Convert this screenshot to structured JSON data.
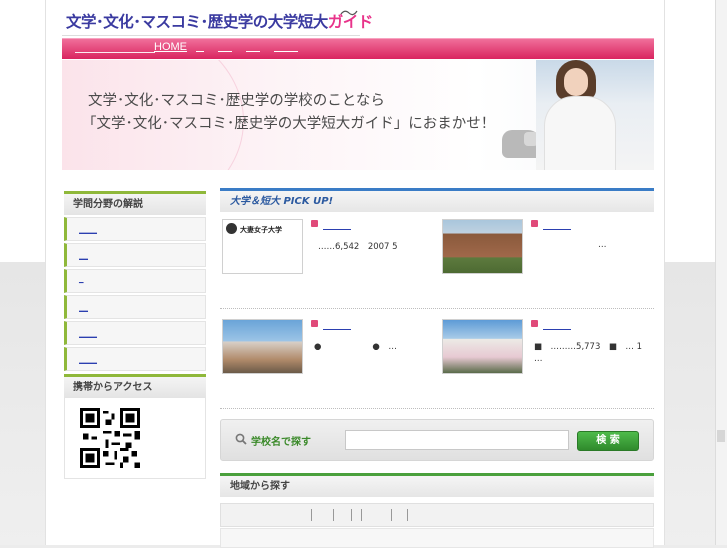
{
  "site": {
    "logo_text": "文学･文化･マスコミ･歴史学の大学短大",
    "logo_guide": "ガイド"
  },
  "nav": {
    "home_label": "HOME"
  },
  "hero": {
    "line1": "文学･文化･マスコミ･歴史学の学校のことなら",
    "line2": "「文学･文化･マスコミ･歴史学の大学短大ガイド」におまかせ！"
  },
  "sidebar": {
    "section1_title": "学問分野の解説",
    "section2_title": "携帯からアクセス",
    "items": [
      {
        "label": "＿＿"
      },
      {
        "label": "＿"
      },
      {
        "label": "_"
      },
      {
        "label": "＿"
      },
      {
        "label": "＿＿"
      },
      {
        "label": "＿＿"
      }
    ]
  },
  "pickup": {
    "title": "大学＆短大 PICK UP!",
    "cards": [
      {
        "thumb_text": "大妻女子大学",
        "text": "……6,542　2007 5"
      },
      {
        "thumb_text": "",
        "text": "…"
      },
      {
        "thumb_text": "",
        "text": "●　　　　　　●　…"
      },
      {
        "thumb_text": "",
        "text": "■　………5,773　■　… 1"
      },
      {
        "thumb_text": "",
        "text": "…"
      }
    ]
  },
  "search": {
    "label": "学校名で探す",
    "input_value": "",
    "button_label": "検 索"
  },
  "region": {
    "title": "地域から探す"
  },
  "colors": {
    "brand_pink": "#d9245f",
    "accent_green": "#8fb83a",
    "accent_blue": "#3a7cc6"
  }
}
